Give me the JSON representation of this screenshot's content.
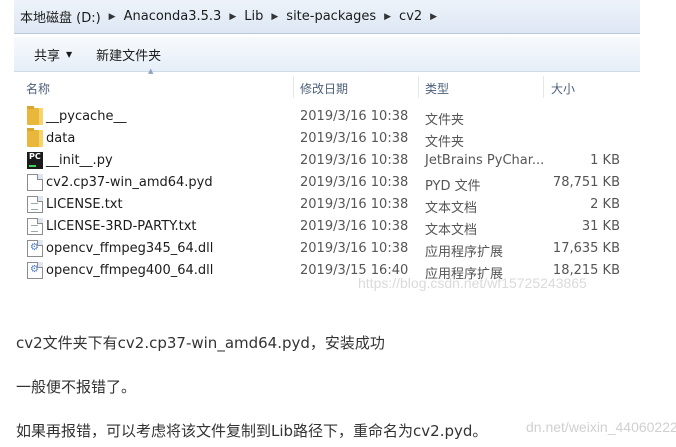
{
  "address": {
    "crumbs": [
      "本地磁盘 (D:)",
      "Anaconda3.5.3",
      "Lib",
      "site-packages",
      "cv2"
    ]
  },
  "toolbar": {
    "share_label": "共享",
    "new_folder_label": "新建文件夹"
  },
  "columns": {
    "name": "名称",
    "date": "修改日期",
    "type": "类型",
    "size": "大小"
  },
  "files": [
    {
      "name": "__pycache__",
      "date": "2019/3/16 10:38",
      "type": "文件夹",
      "size": "",
      "icon": "folder-icon"
    },
    {
      "name": "data",
      "date": "2019/3/16 10:38",
      "type": "文件夹",
      "size": "",
      "icon": "folder-icon"
    },
    {
      "name": "__init__.py",
      "date": "2019/3/16 10:38",
      "type": "JetBrains PyChar...",
      "size": "1 KB",
      "icon": "pycharm-icon"
    },
    {
      "name": "cv2.cp37-win_amd64.pyd",
      "date": "2019/3/16 10:38",
      "type": "PYD 文件",
      "size": "78,751 KB",
      "icon": "file-icon"
    },
    {
      "name": "LICENSE.txt",
      "date": "2019/3/16 10:38",
      "type": "文本文档",
      "size": "2 KB",
      "icon": "text-file-icon"
    },
    {
      "name": "LICENSE-3RD-PARTY.txt",
      "date": "2019/3/16 10:38",
      "type": "文本文档",
      "size": "31 KB",
      "icon": "text-file-icon"
    },
    {
      "name": "opencv_ffmpeg345_64.dll",
      "date": "2019/3/16 10:38",
      "type": "应用程序扩展",
      "size": "17,635 KB",
      "icon": "dll-icon"
    },
    {
      "name": "opencv_ffmpeg400_64.dll",
      "date": "2019/3/15 16:40",
      "type": "应用程序扩展",
      "size": "18,215 KB",
      "icon": "dll-icon"
    }
  ],
  "watermark_top": "https://blog.csdn.net/wf15725243865",
  "article": {
    "line1": "cv2文件夹下有cv2.cp37-win_amd64.pyd，安装成功",
    "line2": "一般便不报错了。",
    "line3": "如果再报错，可以考虑将该文件复制到Lib路径下，重命名为cv2.pyd。"
  },
  "watermark_bottom": "dn.net/weixin_44060222"
}
